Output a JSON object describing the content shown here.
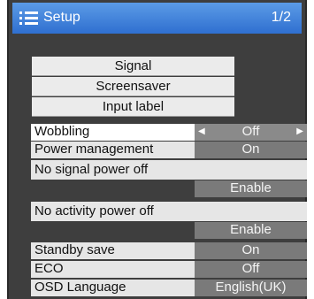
{
  "header": {
    "title": "Setup",
    "page": "1/2",
    "icon": "menu-list-icon"
  },
  "categories": [
    "Signal",
    "Screensaver",
    "Input label"
  ],
  "items": [
    {
      "label": "Wobbling",
      "value": "Off",
      "selected": true
    },
    {
      "label": "Power management",
      "value": "On"
    },
    {
      "label": "No signal power off",
      "value": "Enable"
    },
    {
      "label": "No activity power off",
      "value": "Enable"
    },
    {
      "label": "Standby save",
      "value": "On"
    },
    {
      "label": "ECO",
      "value": "Off"
    },
    {
      "label": "OSD Language",
      "value": "English(UK)"
    }
  ],
  "colors": {
    "title_bar": "#3f82dc",
    "background": "#3e3e3e",
    "label_bg": "#e6e6e6",
    "value_bg": "#7a7a7a"
  }
}
